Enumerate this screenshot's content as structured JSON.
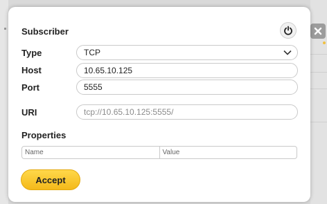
{
  "dialog": {
    "title": "Subscriber",
    "labels": {
      "type": "Type",
      "host": "Host",
      "port": "Port",
      "uri": "URI",
      "properties": "Properties"
    },
    "type_value": "TCP",
    "host_value": "10.65.10.125",
    "port_value": "5555",
    "uri_value": "tcp://10.65.10.125:5555/",
    "properties_table": {
      "columns": [
        "Name",
        "Value"
      ]
    },
    "accept_label": "Accept"
  },
  "colors": {
    "accept_button": "#f4b91a",
    "dialog_background": "#ffffff",
    "close_button": "#9c9c9c"
  },
  "icons": {
    "power": "power-icon",
    "close": "close-icon",
    "dropdown": "chevron-down-icon"
  }
}
